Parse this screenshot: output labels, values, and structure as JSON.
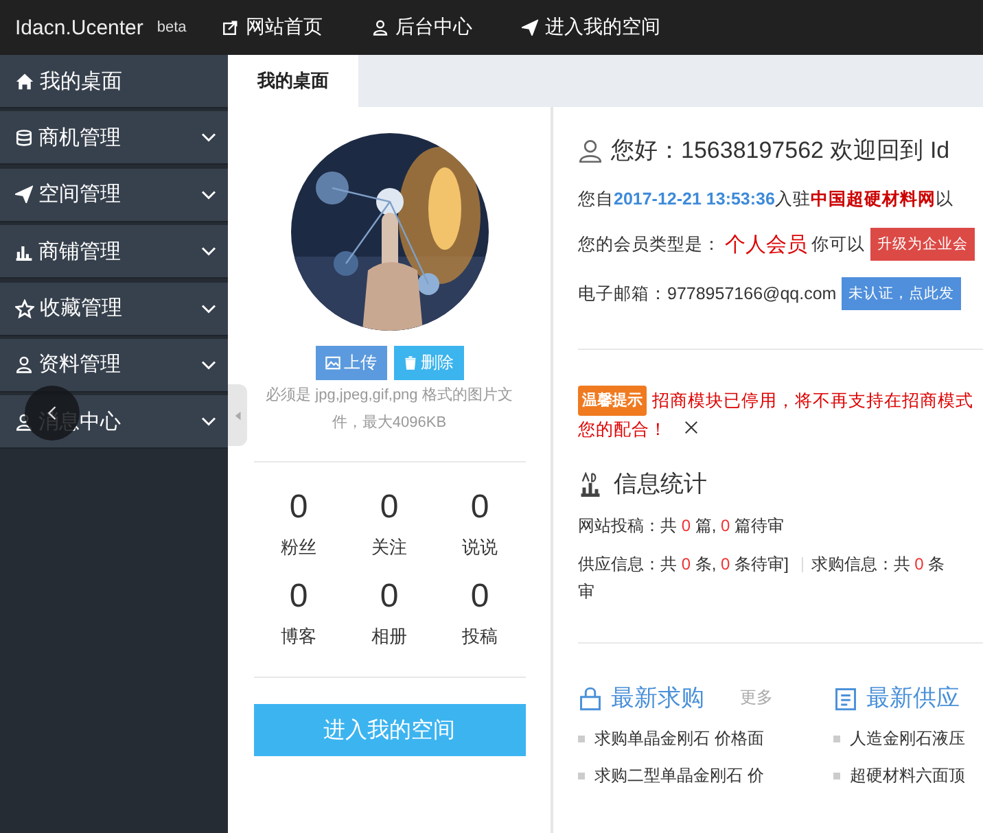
{
  "top_bar": {
    "brand": "Idacn.Ucenter",
    "badge": "beta",
    "links": [
      {
        "label": "网站首页"
      },
      {
        "label": "后台中心"
      },
      {
        "label": "进入我的空间"
      }
    ]
  },
  "sidebar": {
    "items": [
      {
        "label": "我的桌面",
        "expandable": false
      },
      {
        "label": "商机管理",
        "expandable": true
      },
      {
        "label": "空间管理",
        "expandable": true
      },
      {
        "label": "商铺管理",
        "expandable": true
      },
      {
        "label": "收藏管理",
        "expandable": true
      },
      {
        "label": "资料管理",
        "expandable": true
      },
      {
        "label": "消息中心",
        "expandable": true
      }
    ]
  },
  "tabs": [
    {
      "label": "我的桌面",
      "selected": true
    }
  ],
  "profile": {
    "upload_button": "上传",
    "delete_button": "删除",
    "hint": "必须是 jpg,jpeg,gif,png 格式的图片文件，最大4096KB",
    "stats": [
      {
        "value": "0",
        "label": "粉丝"
      },
      {
        "value": "0",
        "label": "关注"
      },
      {
        "value": "0",
        "label": "说说"
      },
      {
        "value": "0",
        "label": "博客"
      },
      {
        "value": "0",
        "label": "相册"
      },
      {
        "value": "0",
        "label": "投稿"
      }
    ],
    "space_button": "进入我的空间"
  },
  "welcome": {
    "greeting": "您好：15638197562 欢迎回到 Id",
    "joined": {
      "prefix": "您自",
      "date": "2017-12-21 13:53:36",
      "middle": "入驻",
      "site": "中国超硬材料网",
      "suffix": "以"
    },
    "membership": {
      "label": "您的会员类型是：",
      "type": "个人会员",
      "suffix": "你可以",
      "upgrade_button": "升级为企业会"
    },
    "email": {
      "label": "电子邮箱：",
      "value": "9778957166@qq.com",
      "verify_button": "未认证，点此发"
    }
  },
  "notice": {
    "badge": "温馨提示",
    "lines": [
      "招商模块已停用，将不再支持在招商模式",
      "您的配合！"
    ]
  },
  "info_stats": {
    "title": "信息统计",
    "rows": [
      [
        {
          "text": "网站投稿：共 ",
          "highlight": false
        },
        {
          "text": "0",
          "highlight": true
        },
        {
          "text": " 篇, ",
          "highlight": false
        },
        {
          "text": "0",
          "highlight": true
        },
        {
          "text": " 篇待审",
          "highlight": false
        }
      ],
      [
        {
          "text": "供应信息：共 ",
          "highlight": false
        },
        {
          "text": "0",
          "highlight": true
        },
        {
          "text": " 条, ",
          "highlight": false
        },
        {
          "text": "0",
          "highlight": true
        },
        {
          "text": " 条待审] ",
          "highlight": false
        }
      ],
      [
        {
          "text": "求购信息：共 ",
          "highlight": false
        },
        {
          "text": "0",
          "highlight": true
        },
        {
          "text": " 条",
          "highlight": false
        }
      ],
      [
        {
          "text": "审",
          "highlight": false
        }
      ]
    ]
  },
  "latest": [
    {
      "title": "最新求购",
      "more": "更多",
      "items": [
        "求购单晶金刚石 价格面",
        "求购二型单晶金刚石 价"
      ]
    },
    {
      "title": "最新供应",
      "items": [
        "人造金刚石液压",
        "超硬材料六面顶"
      ]
    }
  ]
}
